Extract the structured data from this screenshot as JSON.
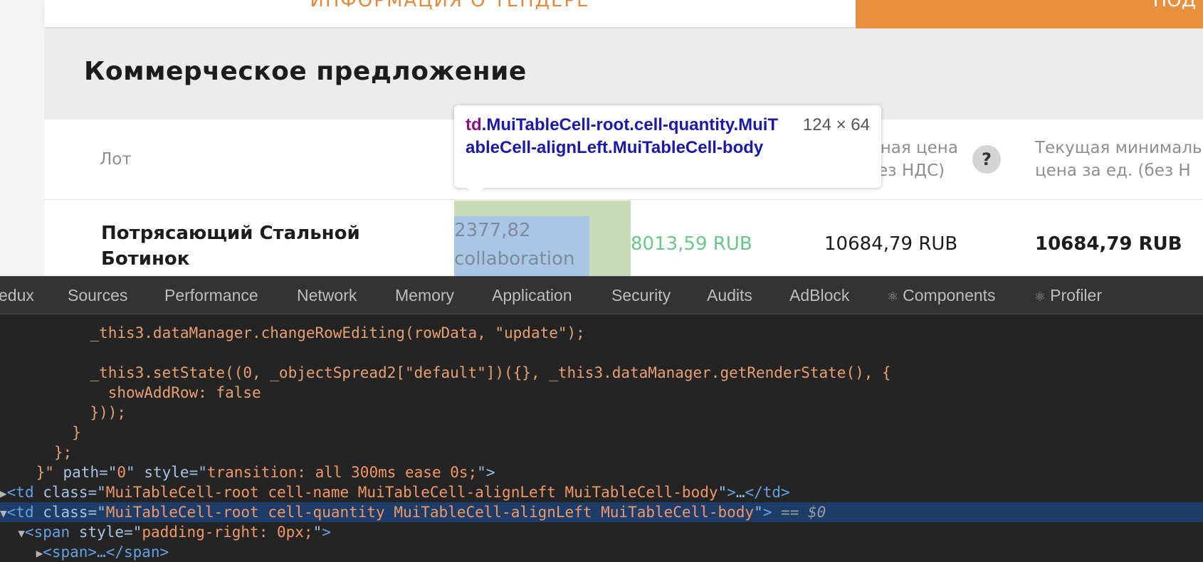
{
  "page": {
    "tab_info_label": "ИНФОРМАЦИЯ О ТЕНДЕРЕ",
    "orange_button_label": "ПОД",
    "section_title": "Коммерческое предложение",
    "table": {
      "headers": {
        "lot": "Лот",
        "start_price_line1": "осная цена",
        "start_price_line2": "(без НДС)",
        "current_price_line1": "Текущая минималь",
        "current_price_line2": "цена за ед. (без Н"
      },
      "help_icon_glyph": "?",
      "row": {
        "name_line1": "Потрясающий Стальной",
        "name_line2": "Ботинок",
        "quantity_line1": "2377,82",
        "quantity_line2": "collaboration",
        "bid_price": "8013,59 RUB",
        "start_price": "10684,79 RUB",
        "current_price": "10684,79 RUB"
      }
    }
  },
  "inspector_tooltip": {
    "tag": "td",
    "classes": ".MuiTableCell-root.cell-quantity.MuiTableCell-alignLeft.MuiTableCell-body",
    "size": "124 × 64"
  },
  "devtools": {
    "tabs": [
      "edux",
      "Sources",
      "Performance",
      "Network",
      "Memory",
      "Application",
      "Security",
      "Audits",
      "AdBlock",
      "Components",
      "Profiler"
    ],
    "react_icon": "⚛",
    "code_lines": [
      "          _this3.dataManager.changeRowEditing(rowData, \"update\");",
      "",
      "          _this3.setState((0, _objectSpread2[\"default\"])({}, _this3.dataManager.getRenderState(), {",
      "            showAddRow: false",
      "          }));",
      "        }",
      "      };",
      "    }\""
    ],
    "line8": {
      "path_attr": "path",
      "path_val": "0",
      "style_attr": "style",
      "style_val": "transition: all 300ms ease 0s;"
    },
    "line9": {
      "tag": "td",
      "class_attr": "class",
      "class_val": "MuiTableCell-root cell-name MuiTableCell-alignLeft MuiTableCell-body",
      "collapsed": "…",
      "close_tag": "</td>"
    },
    "line10": {
      "tag": "td",
      "class_attr": "class",
      "class_val": "MuiTableCell-root cell-quantity MuiTableCell-alignLeft MuiTableCell-body",
      "marker": "== $0"
    },
    "line11": {
      "tag": "span",
      "style_attr": "style",
      "style_val": "padding-right: 0px;"
    },
    "line12": {
      "text": "<span>…</span>"
    },
    "colors": {
      "selected_row": "#1d3d68",
      "orange": "#e8903d",
      "highlight_green": "#c5dcb6",
      "highlight_blue": "#a9c6e6"
    }
  }
}
